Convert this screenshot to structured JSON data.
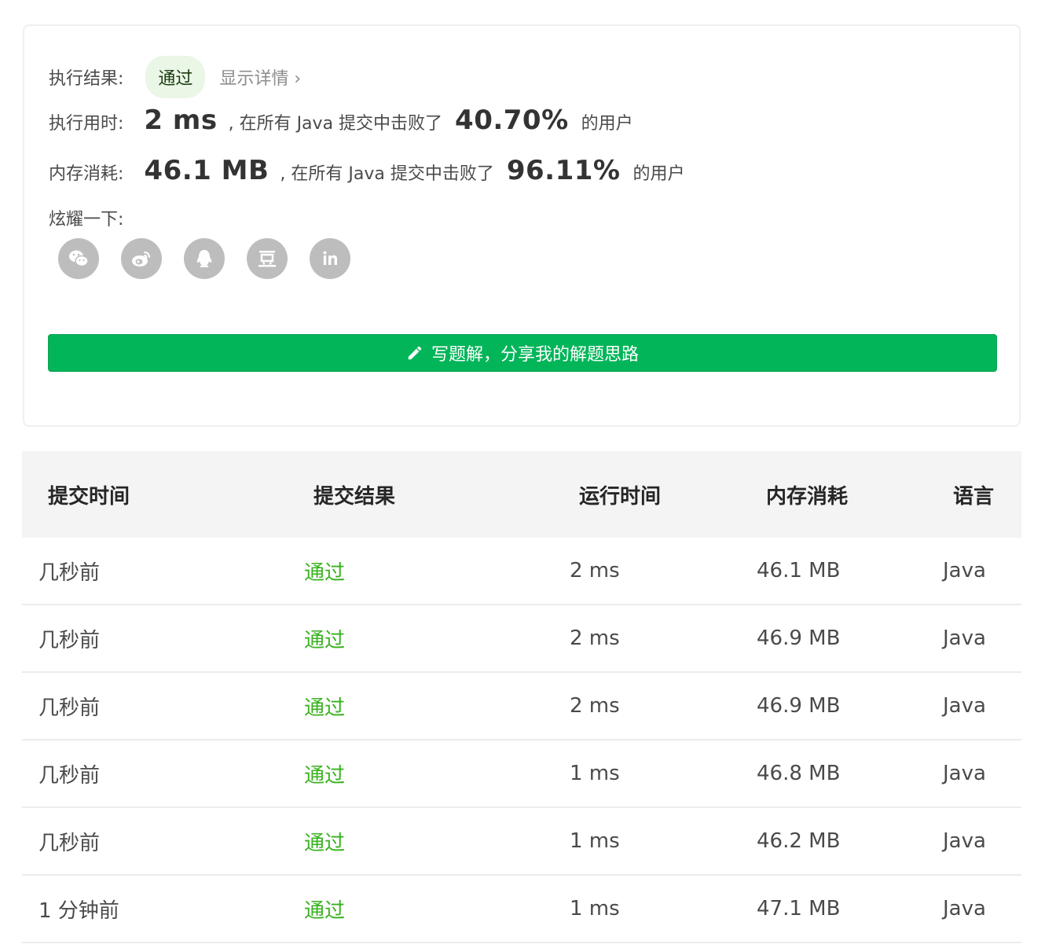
{
  "summary": {
    "result_label": "执行结果:",
    "result_value": "通过",
    "detail_link": "显示详情 ›",
    "time_label": "执行用时:",
    "time_value": "2 ms",
    "time_note_pre": ", 在所有 Java 提交中击败了",
    "time_pct": "40.70%",
    "time_note_post": "的用户",
    "mem_label": "内存消耗:",
    "mem_value": "46.1 MB",
    "mem_note_pre": ", 在所有 Java 提交中击败了",
    "mem_pct": "96.11%",
    "mem_note_post": "的用户",
    "share_label": "炫耀一下:",
    "share_icons": [
      "wechat-icon",
      "weibo-icon",
      "qq-icon",
      "douban-icon",
      "linkedin-icon"
    ],
    "write_button": "写题解，分享我的解题思路"
  },
  "table": {
    "headers": [
      "提交时间",
      "提交结果",
      "运行时间",
      "内存消耗",
      "语言"
    ],
    "rows": [
      [
        "几秒前",
        "通过",
        "2 ms",
        "46.1 MB",
        "Java"
      ],
      [
        "几秒前",
        "通过",
        "2 ms",
        "46.9 MB",
        "Java"
      ],
      [
        "几秒前",
        "通过",
        "2 ms",
        "46.9 MB",
        "Java"
      ],
      [
        "几秒前",
        "通过",
        "1 ms",
        "46.8 MB",
        "Java"
      ],
      [
        "几秒前",
        "通过",
        "1 ms",
        "46.2 MB",
        "Java"
      ],
      [
        "1 分钟前",
        "通过",
        "1 ms",
        "47.1 MB",
        "Java"
      ]
    ]
  },
  "colors": {
    "accent_green": "#02b559",
    "status_green": "#38b21f",
    "pill_bg": "#eaf6e6",
    "icon_gray": "#bdbdbd"
  }
}
